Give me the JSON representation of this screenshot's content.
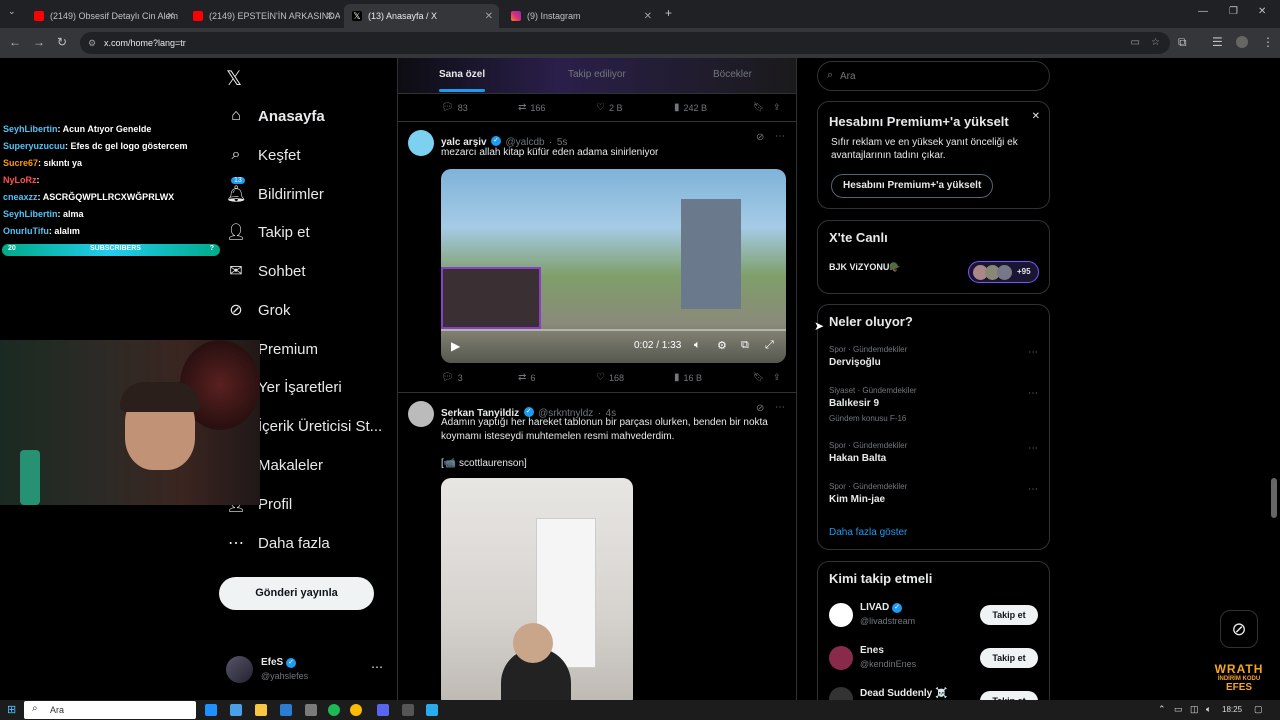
{
  "browser": {
    "tabs": [
      {
        "title": "(2149) Obsesif Detaylı Cin Alem",
        "active": false
      },
      {
        "title": "(2149) EPSTEİN'İN ARKASINDAN",
        "active": false
      },
      {
        "title": "(13) Anasayfa / X",
        "active": true
      },
      {
        "title": "(9) Instagram",
        "active": false
      }
    ],
    "url": "x.com/home?lang=tr"
  },
  "nav": {
    "home": "Anasayfa",
    "explore": "Keşfet",
    "notifications": "Bildirimler",
    "notif_badge": "13",
    "follow": "Takip et",
    "chat": "Sohbet",
    "grok": "Grok",
    "premium": "Premium",
    "bookmarks": "Yer İşaretleri",
    "creator": "İçerik Üreticisi St...",
    "articles": "Makaleler",
    "profile": "Profil",
    "more": "Daha fazla",
    "post": "Gönderi yayınla",
    "account_name": "EfeS",
    "account_handle": "@yahslefes"
  },
  "feed": {
    "tabs": [
      "Sana özel",
      "Takip ediliyor",
      "Böcekler"
    ],
    "prev_actions": {
      "replies": "83",
      "reposts": "166",
      "likes": "2 B",
      "views": "242 B"
    },
    "tweet1": {
      "name": "yalc arşiv",
      "handle": "@yalcdb",
      "time": "5s",
      "text": "mezarcı allah kitap küfür eden adama sinirleniyor",
      "video_time": "0:02 / 1:33",
      "replies": "3",
      "reposts": "6",
      "likes": "168",
      "views": "16 B"
    },
    "tweet2": {
      "name": "Serkan Tanyildiz",
      "handle": "@srkntnyldz",
      "time": "4s",
      "text": "Adamın yaptığı her hareket tablonun bir parçası olurken, benden bir nokta koymamı isteseydi muhtemelen resmi mahvederdim.",
      "credit": "[📹 scottlaurenson]"
    }
  },
  "right": {
    "search_placeholder": "Ara",
    "premium": {
      "title": "Hesabını Premium+'a yükselt",
      "desc": "Sıfır reklam ve en yüksek yanıt önceliği ek avantajlarının tadını çıkar.",
      "button": "Hesabını Premium+'a yükselt"
    },
    "live": {
      "title": "X'te Canlı",
      "item": "BJK ViZYONU🪖",
      "count": "+95"
    },
    "trends": {
      "title": "Neler oluyor?",
      "items": [
        {
          "category": "Spor · Gündemdekiler",
          "name": "Dervişoğlu",
          "extra": ""
        },
        {
          "category": "Siyaset · Gündemdekiler",
          "name": "Balıkesir 9",
          "extra": "Gündem konusu F-16"
        },
        {
          "category": "Spor · Gündemdekiler",
          "name": "Hakan Balta",
          "extra": ""
        },
        {
          "category": "Spor · Gündemdekiler",
          "name": "Kim Min-jae",
          "extra": ""
        }
      ],
      "show_more": "Daha fazla göster"
    },
    "who_to_follow": {
      "title": "Kimi takip etmeli",
      "users": [
        {
          "name": "LIVAD",
          "handle": "@livadstream",
          "button": "Takip et"
        },
        {
          "name": "Enes",
          "handle": "@kendinEnes",
          "button": "Takip et"
        },
        {
          "name": "Dead Suddenly ☠️",
          "handle": "",
          "button": "Takip et"
        }
      ]
    }
  },
  "stream": {
    "chat": [
      {
        "user": "SeyhLibertin",
        "msg": ": Acun Atıyor Genelde",
        "color": "#4fc3f7"
      },
      {
        "user": "Superyuzucuu",
        "msg": ": Efes dc gel logo göstercem",
        "color": "#4fc3f7"
      },
      {
        "user": "Sucre67",
        "msg": ": sıkıntı ya",
        "color": "#ff9800"
      },
      {
        "user": "NyLoRz",
        "msg": ":",
        "color": "#ff5252"
      },
      {
        "user": "cneaxzz",
        "msg": ": ASCRĞQWPLLRCXWĞPRLWX",
        "color": "#4fc3f7"
      },
      {
        "user": "SeyhLibertin",
        "msg": ": alma",
        "color": "#4fc3f7"
      },
      {
        "user": "OnurluTifu",
        "msg": ": alalım",
        "color": "#4fc3f7"
      }
    ],
    "subs_label": "SUBSCRIBERS",
    "subs_left": "20",
    "subs_right": "?",
    "logo_top": "WRATH",
    "logo_mid": "İNDİRİM KODU",
    "logo_bottom": "EFES"
  },
  "taskbar": {
    "search": "Ara",
    "time": "18:25"
  }
}
